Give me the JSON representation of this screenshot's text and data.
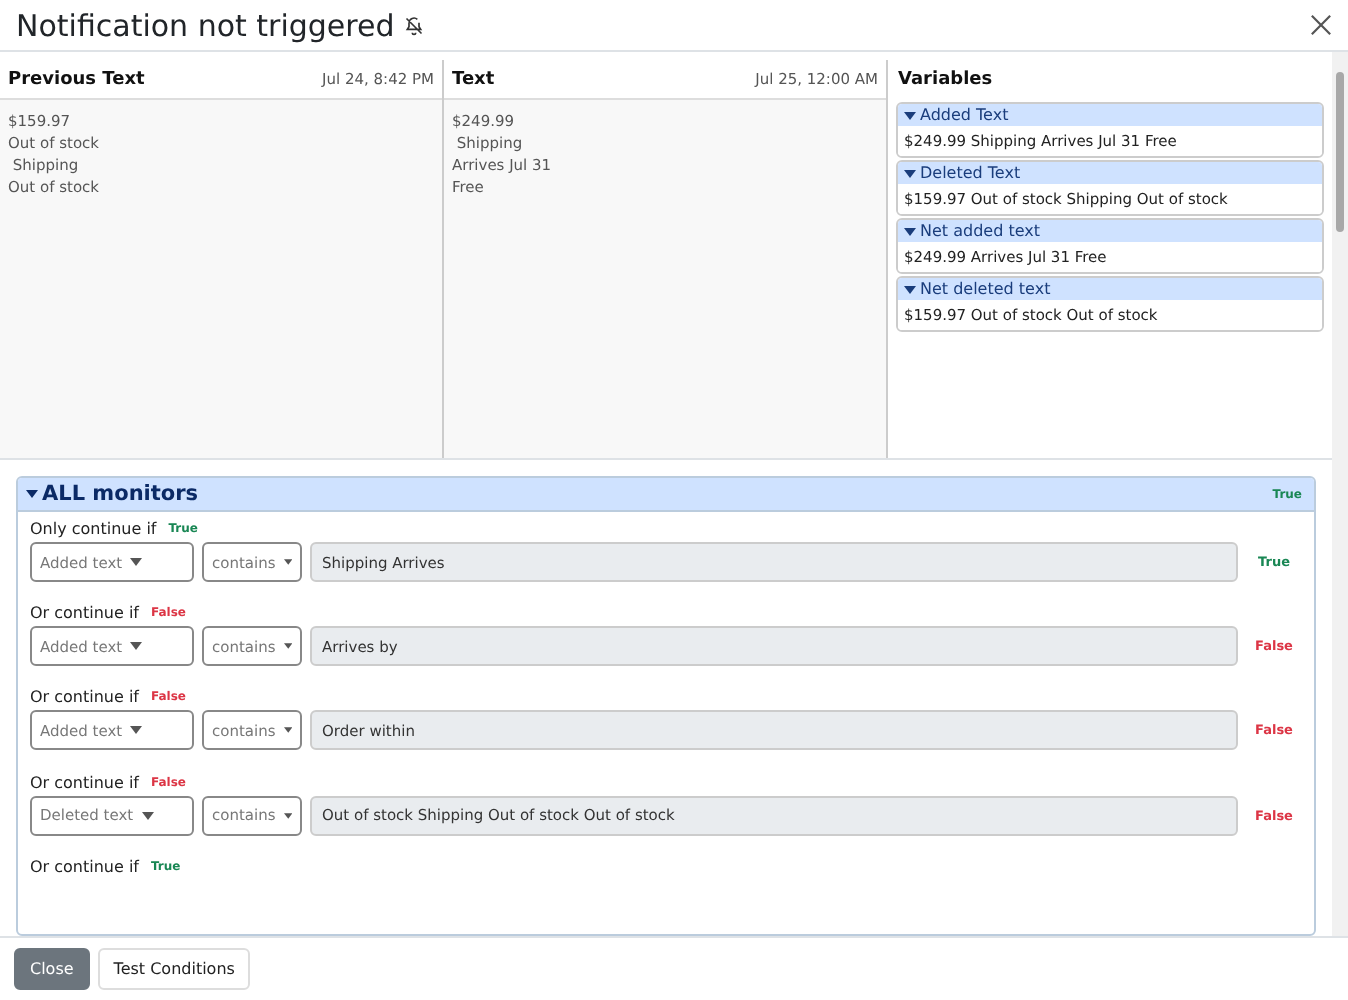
{
  "dialog": {
    "title": "Notification not triggered"
  },
  "previous_text": {
    "heading": "Previous Text",
    "timestamp": "Jul 24, 8:42 PM",
    "lines": [
      "$159.97",
      "Out of stock",
      " Shipping",
      "Out of stock"
    ]
  },
  "text": {
    "heading": "Text",
    "timestamp": "Jul 25, 12:00 AM",
    "lines": [
      "$249.99",
      " Shipping",
      "Arrives Jul 31",
      "Free"
    ]
  },
  "variables": {
    "heading": "Variables",
    "items": [
      {
        "name": "Added Text",
        "value": "$249.99 Shipping Arrives Jul 31 Free",
        "expanded": true
      },
      {
        "name": "Deleted Text",
        "value": "$159.97 Out of stock Shipping Out of stock",
        "expanded": true
      },
      {
        "name": "Net added text",
        "value": "$249.99 Arrives Jul 31 Free",
        "expanded": true
      },
      {
        "name": "Net deleted text",
        "value": "$159.97 Out of stock Out of stock",
        "expanded": true
      }
    ]
  },
  "monitors": {
    "title": "ALL monitors",
    "result": "True",
    "expanded": true,
    "conditions": [
      {
        "label": "Only continue if",
        "result": "True",
        "source": "Added text",
        "operator": "contains",
        "value": "Shipping Arrives",
        "row_result": "True"
      },
      {
        "label": "Or continue if",
        "result": "False",
        "source": "Added text",
        "operator": "contains",
        "value": "Arrives by",
        "row_result": "False"
      },
      {
        "label": "Or continue if",
        "result": "False",
        "source": "Added text",
        "operator": "contains",
        "value": "Order within",
        "row_result": "False"
      },
      {
        "label": "Or continue if",
        "result": "False",
        "source": "Deleted text",
        "operator": "contains",
        "value": "Out of stock Shipping Out of stock Out of stock",
        "row_result": "False"
      },
      {
        "label": "Or continue if",
        "result": "True"
      }
    ]
  },
  "footer": {
    "buttons": [
      {
        "label": "Close",
        "kind": "primary"
      },
      {
        "label": "Test Conditions",
        "kind": "secondary"
      }
    ]
  }
}
